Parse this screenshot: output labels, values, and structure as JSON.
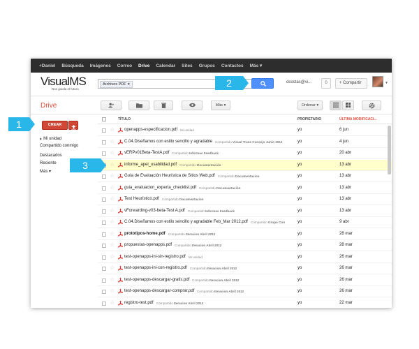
{
  "topbar": {
    "items": [
      {
        "label": "+Daniel"
      },
      {
        "label": "Búsqueda"
      },
      {
        "label": "Imágenes"
      },
      {
        "label": "Correo"
      },
      {
        "label": "Drive"
      },
      {
        "label": "Calendar"
      },
      {
        "label": "Sites"
      },
      {
        "label": "Grupos"
      },
      {
        "label": "Contactos"
      },
      {
        "label": "Más ▾"
      }
    ],
    "active": "Drive"
  },
  "header": {
    "logo_text": "VisualMS",
    "logo_tagline": "Nos guiala el futuro",
    "search_chip": "Archivos PDF",
    "search_chip_close": "×",
    "user_email": "dcostas@vi...",
    "notifications": "0",
    "share_label": "+ Compartir"
  },
  "toolbar": {
    "title": "Drive",
    "more_label": "Más ▾",
    "sort_label": "Ordenar ▾"
  },
  "sidebar": {
    "create_label": "CREAR",
    "items": [
      {
        "label": "Mi unidad"
      },
      {
        "label": "Compartido conmigo"
      },
      {
        "label": "Destacados"
      },
      {
        "label": "Reciente"
      },
      {
        "label": "Más ▾"
      }
    ]
  },
  "list": {
    "headers": {
      "title": "TÍTULO",
      "owner": "PROPIETARIO",
      "modified": "ÚLTIMA MODIFICACI..."
    },
    "rows": [
      {
        "name": "openapps-especificacion.pdf",
        "tag": "Mi unidad",
        "tag_bold": "",
        "owner": "yo",
        "date": "6 jun"
      },
      {
        "name": "C.04.Diseñamos con estilo sencillo y agradable",
        "tag": "Compartido",
        "tag_bold": "Visual Trans Consejo Junio 2012",
        "owner": "yo",
        "date": "4 jun"
      },
      {
        "name": "vERPv01Beta-TestA.pdf",
        "tag": "Compartido",
        "tag_bold": "Informes Feedback",
        "owner": "yo",
        "date": "20 abr"
      },
      {
        "name": "informe_apei_usabilidad.pdf",
        "tag": "Compartido",
        "tag_bold": "Documentación",
        "owner": "yo",
        "date": "13 abr"
      },
      {
        "name": "Guía de Evaluación Heurística de Sitios Web.pdf",
        "tag": "Compartido",
        "tag_bold": "Documentacion",
        "owner": "yo",
        "date": "13 abr"
      },
      {
        "name": "guia_evaluacion_experta_checklist.pdf",
        "tag": "Compartido",
        "tag_bold": "Documentación",
        "owner": "yo",
        "date": "13 abr"
      },
      {
        "name": "Test Heurístico.pdf",
        "tag": "Compartido",
        "tag_bold": "Documentacion",
        "owner": "yo",
        "date": "13 abr"
      },
      {
        "name": "vForwarding-v03-beta-Test A.pdf",
        "tag": "Compartido",
        "tag_bold": "Informes Feedback",
        "owner": "yo",
        "date": "13 abr"
      },
      {
        "name": "C.04.Diseñamos con estilo sencillo y agradable Feb_Mar 2012.pdf",
        "tag": "Compartido",
        "tag_bold": "Grupo Con",
        "owner": "yo",
        "date": "9 abr"
      },
      {
        "name": "prototipos-home.pdf",
        "tag": "Compartido",
        "tag_bold": "Iteracion Abril 2012",
        "owner": "yo",
        "date": "28 mar"
      },
      {
        "name": "propuestas-openapps.pdf",
        "tag": "Compartido",
        "tag_bold": "Iteracion Abril 2012",
        "owner": "yo",
        "date": "28 mar"
      },
      {
        "name": "test-openapps-ini-sin-registro.pdf",
        "tag": "Mi unidad",
        "tag_bold": "",
        "owner": "yo",
        "date": "26 mar"
      },
      {
        "name": "test-openapps-ini-con-registro.pdf",
        "tag": "Compartido",
        "tag_bold": "Iteracion Abril 2012",
        "owner": "yo",
        "date": "26 mar"
      },
      {
        "name": "test-openapps-descargar-gratis.pdf",
        "tag": "Compartido",
        "tag_bold": "Iteracion Abril 2012",
        "owner": "yo",
        "date": "26 mar"
      },
      {
        "name": "test-openapps-descargar-comprar.pdf",
        "tag": "Compartido",
        "tag_bold": "Iteracion Abril 2012",
        "owner": "yo",
        "date": "26 mar"
      },
      {
        "name": "registro-test.pdf",
        "tag": "Compartido",
        "tag_bold": "Iteracion Abril 2012",
        "owner": "yo",
        "date": "22 mar"
      }
    ]
  },
  "callouts": [
    {
      "label": "1"
    },
    {
      "label": "2"
    },
    {
      "label": "3"
    }
  ],
  "colors": {
    "topbar_bg": "#2d2d2d",
    "accent_red": "#d14836",
    "search_blue": "#4d90fe",
    "selected_row": "#ffffcc",
    "callout": "#29b6e8"
  }
}
